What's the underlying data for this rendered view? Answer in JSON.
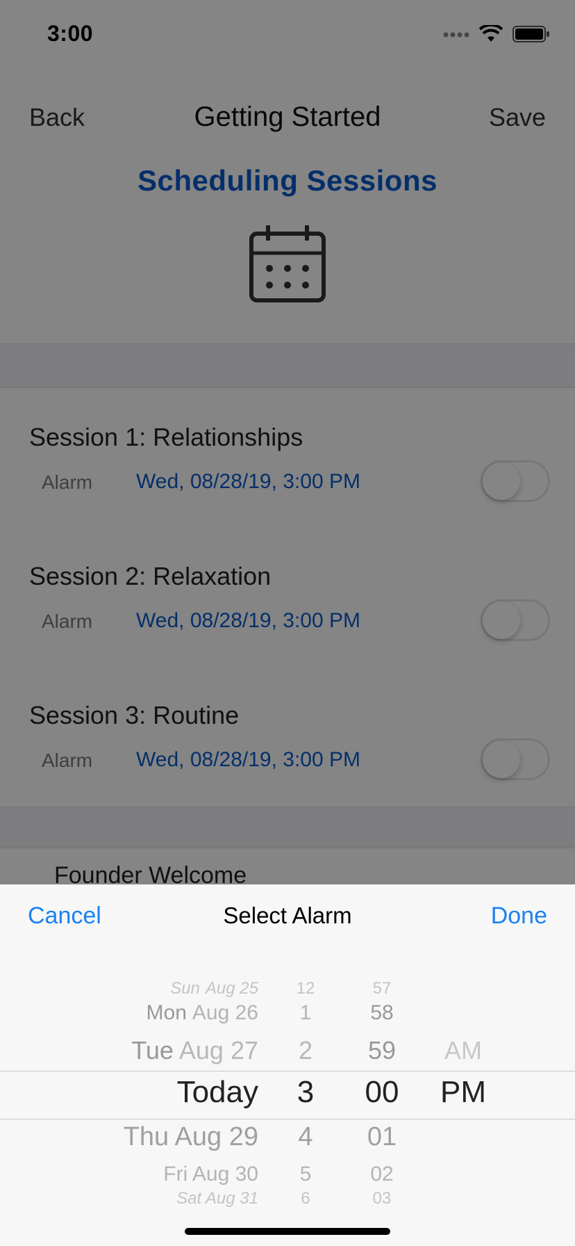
{
  "status_bar": {
    "time": "3:00"
  },
  "nav": {
    "back": "Back",
    "title": "Getting Started",
    "save": "Save"
  },
  "header": {
    "title": "Scheduling Sessions"
  },
  "sessions": [
    {
      "title": "Session 1: Relationships",
      "alarm_label": "Alarm",
      "alarm_value": "Wed, 08/28/19, 3:00 PM",
      "enabled": false
    },
    {
      "title": "Session 2: Relaxation",
      "alarm_label": "Alarm",
      "alarm_value": "Wed, 08/28/19, 3:00 PM",
      "enabled": false
    },
    {
      "title": "Session 3: Routine",
      "alarm_label": "Alarm",
      "alarm_value": "Wed, 08/28/19, 3:00 PM",
      "enabled": false
    }
  ],
  "next_section": {
    "title": "Founder Welcome"
  },
  "picker_sheet": {
    "cancel": "Cancel",
    "title": "Select Alarm",
    "done": "Done",
    "dates": [
      "Sun",
      "Aug 25",
      "Mon",
      "Aug 26",
      "Tue",
      "Aug 27",
      "Today",
      "Thu Aug 29",
      "Fri Aug 30",
      "Sat Aug 31"
    ],
    "hours": [
      "12",
      "1",
      "2",
      "3",
      "4",
      "5",
      "6"
    ],
    "minutes": [
      "57",
      "58",
      "59",
      "00",
      "01",
      "02",
      "03"
    ],
    "ampm": [
      "AM",
      "PM"
    ],
    "selected": {
      "date": "Today",
      "hour": "3",
      "minute": "00",
      "ampm": "PM"
    }
  },
  "colors": {
    "accent": "#1a82f0",
    "link": "#0a5bcc"
  }
}
